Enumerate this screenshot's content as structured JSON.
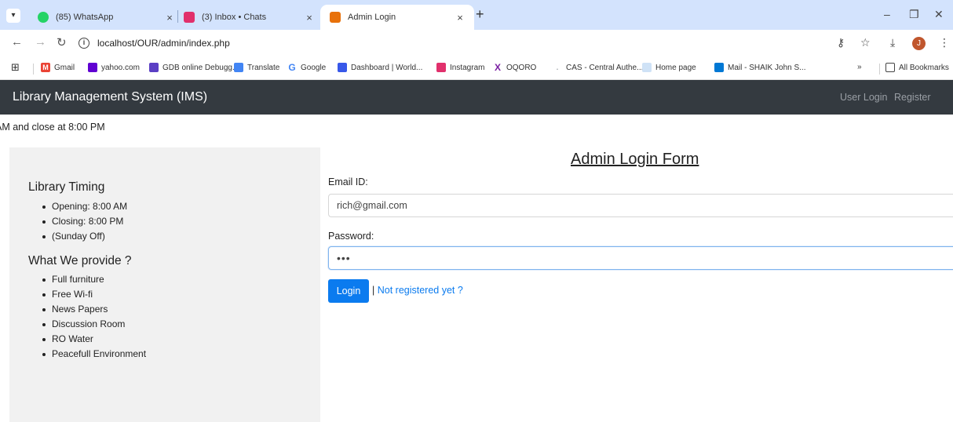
{
  "browser": {
    "tabs": [
      {
        "title": "(85) WhatsApp",
        "favicon": "whatsapp-icon",
        "color": "#25d366",
        "active": false
      },
      {
        "title": "(3) Inbox • Chats",
        "favicon": "instagram-icon",
        "color": "#e1306c",
        "active": false
      },
      {
        "title": "Admin Login",
        "favicon": "site-icon",
        "color": "#e8710a",
        "active": true
      }
    ],
    "url": "localhost/OUR/admin/index.php",
    "profile_initial": "J",
    "bookmarks": [
      {
        "label": "Gmail",
        "icon": "gmail-icon",
        "color": "#ea4335"
      },
      {
        "label": "yahoo.com",
        "icon": "yahoo-icon",
        "color": "#6001d2"
      },
      {
        "label": "GDB online Debugg...",
        "icon": "gdb-icon",
        "color": "#5b3fc4"
      },
      {
        "label": "Translate",
        "icon": "translate-icon",
        "color": "#4285f4"
      },
      {
        "label": "Google",
        "icon": "google-icon",
        "color": "#4285f4"
      },
      {
        "label": "Dashboard | World...",
        "icon": "wordpress-icon",
        "color": "#3858e9"
      },
      {
        "label": "Instagram",
        "icon": "instagram-icon",
        "color": "#e1306c"
      },
      {
        "label": "OQORO",
        "icon": "oqoro-icon",
        "color": "#7a1fa2"
      },
      {
        "label": "CAS - Central Authe...",
        "icon": "cas-icon",
        "color": "#9aa0a6"
      },
      {
        "label": "Home page",
        "icon": "homepage-icon",
        "color": "#7fb0e0"
      },
      {
        "label": "Mail - SHAIK John S...",
        "icon": "outlook-icon",
        "color": "#0078d4"
      }
    ],
    "bookmarks_overflow": "»",
    "all_bookmarks": "All Bookmarks"
  },
  "navbar": {
    "brand": "Library Management System (IMS)",
    "links": [
      "User Login",
      "Register"
    ]
  },
  "marquee": "AM and close at 8:00 PM",
  "sidebar": {
    "timing_heading": "Library Timing",
    "timing_items": [
      "Opening: 8:00 AM",
      "Closing: 8:00 PM",
      "(Sunday Off)"
    ],
    "provide_heading": "What We provide ?",
    "provide_items": [
      "Full furniture",
      "Free Wi-fi",
      "News Papers",
      "Discussion Room",
      "RO Water",
      "Peacefull Environment"
    ]
  },
  "form": {
    "title": "Admin Login Form",
    "email_label": "Email ID:",
    "email_value": "rich@gmail.com",
    "password_label": "Password:",
    "password_value": "•••",
    "login_button": "Login",
    "separator": "|",
    "register_link": "Not registered yet ?"
  },
  "colors": {
    "navbar": "#343a40",
    "primary": "#0b7bef",
    "tabstrip": "#d3e3fd"
  }
}
